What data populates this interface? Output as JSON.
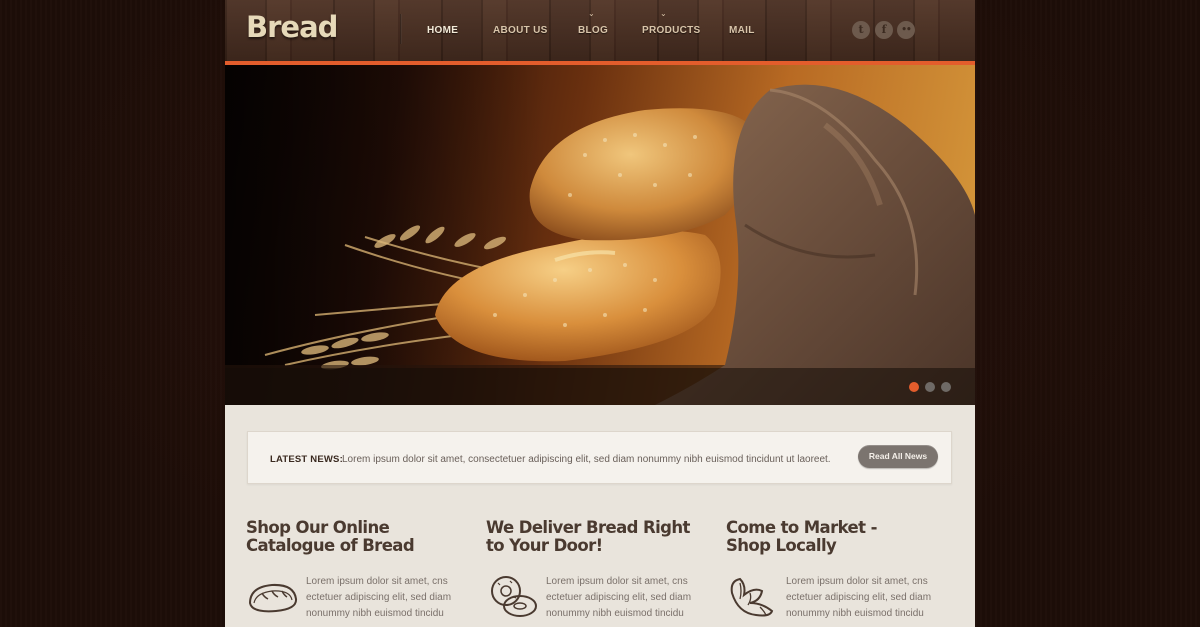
{
  "brand": {
    "logo": "Bread"
  },
  "nav": {
    "items": [
      {
        "label": "HOME",
        "active": true,
        "has_dropdown": false
      },
      {
        "label": "ABOUT US",
        "active": false,
        "has_dropdown": false
      },
      {
        "label": "BLOG",
        "active": false,
        "has_dropdown": true
      },
      {
        "label": "PRODUCTS",
        "active": false,
        "has_dropdown": true
      },
      {
        "label": "MAIL",
        "active": false,
        "has_dropdown": false
      }
    ]
  },
  "social": [
    {
      "icon": "tumblr-icon",
      "glyph": "t"
    },
    {
      "icon": "facebook-icon",
      "glyph": "f"
    },
    {
      "icon": "flickr-icon",
      "glyph": "••"
    }
  ],
  "slider": {
    "slide_count": 3,
    "active_slide": 1
  },
  "news": {
    "label": "LATEST NEWS:",
    "text": "Lorem ipsum dolor sit amet, consectetuer adipiscing elit, sed diam nonummy nibh euismod tincidunt ut laoreet.",
    "button": "Read All News"
  },
  "columns": [
    {
      "title_line1": "Shop Our Online",
      "title_line2": "Catalogue of Bread",
      "icon": "bread-loaf-icon",
      "text": [
        "Lorem ipsum dolor sit amet, cns",
        "ectetuer adipiscing elit, sed diam",
        "nonummy nibh euismod tincidu"
      ]
    },
    {
      "title_line1": "We Deliver Bread Right",
      "title_line2": "to Your Door!",
      "icon": "bagels-icon",
      "text": [
        "Lorem ipsum dolor sit amet, cns",
        "ectetuer adipiscing elit, sed diam",
        "nonummy nibh euismod tincidu"
      ]
    },
    {
      "title_line1": "Come to Market -",
      "title_line2": "Shop Locally",
      "icon": "croissant-icon",
      "text": [
        "Lorem ipsum dolor sit amet, cns",
        "ectetuer adipiscing elit, sed diam",
        "nonummy nibh euismod tincidu"
      ]
    }
  ],
  "colors": {
    "accent": "#e35d2c",
    "header_wood": "#4a2f22",
    "content_bg": "#e9e4dc",
    "page_bg": "#1d0d08"
  }
}
